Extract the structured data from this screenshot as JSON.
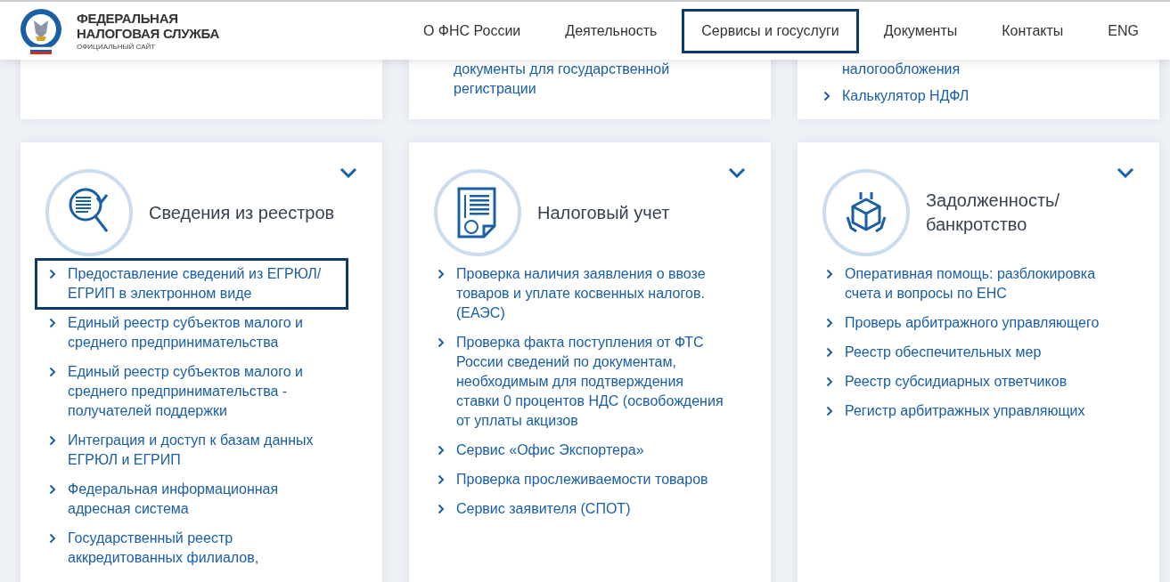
{
  "header": {
    "logo": {
      "title_line_1": "ФЕДЕРАЛЬНАЯ",
      "title_line_2": "НАЛОГОВАЯ СЛУЖБА",
      "subtitle": "ОФИЦИАЛЬНЫЙ САЙТ"
    },
    "nav": [
      {
        "label": "О ФНС России",
        "selected": false
      },
      {
        "label": "Деятельность",
        "selected": false
      },
      {
        "label": "Сервисы и госуслуги",
        "selected": true
      },
      {
        "label": "Документы",
        "selected": false
      },
      {
        "label": "Контакты",
        "selected": false
      },
      {
        "label": "ENG",
        "selected": false
      }
    ]
  },
  "top_cards": [
    {
      "kind": "blank"
    },
    {
      "kind": "links",
      "items": [
        {
          "kind": "continuation",
          "text": "документы для государственной"
        },
        {
          "kind": "continuation",
          "text": "регистрации"
        }
      ]
    },
    {
      "kind": "links",
      "items": [
        {
          "kind": "continuation",
          "text": "налогообложения"
        },
        {
          "kind": "link",
          "text": "Калькулятор НДФЛ"
        }
      ]
    }
  ],
  "sections": [
    {
      "title": "Сведения из реестров",
      "expanded": false,
      "items": [
        {
          "text": "Предоставление сведений из ЕГРЮЛ/ ЕГРИП в электронном виде",
          "selected": true
        },
        {
          "text": "Единый реестр субъектов малого и среднего предпринимательства",
          "selected": false
        },
        {
          "text": "Единый реестр субъектов малого и среднего предпринимательства - получателей поддержки",
          "selected": false
        },
        {
          "text": "Интеграция и доступ к базам данных ЕГРЮЛ и ЕГРИП",
          "selected": false
        },
        {
          "text": "Федеральная информационная адресная система",
          "selected": false
        },
        {
          "text": "Государственный реестр аккредитованных филиалов,",
          "selected": false
        }
      ]
    },
    {
      "title": "Налоговый учет",
      "expanded": false,
      "items": [
        {
          "text": "Проверка наличия заявления о ввозе товаров и уплате косвенных налогов. (ЕАЭС)",
          "selected": false
        },
        {
          "text": "Проверка факта поступления от ФТС России сведений по документам, необходимым для подтверждения ставки 0 процентов НДС (освобождения от уплаты акцизов",
          "selected": false
        },
        {
          "text": "Сервис «Офис Экспортера»",
          "selected": false
        },
        {
          "text": "Проверка прослеживаемости товаров",
          "selected": false
        },
        {
          "text": "Сервис заявителя (СПОТ)",
          "selected": false
        }
      ]
    },
    {
      "title": "Задолженность/ банкротство",
      "expanded": false,
      "items": [
        {
          "text": "Оперативная помощь: разблокировка счета и вопросы по ЕНС",
          "selected": false
        },
        {
          "text": "Проверь арбитражного управляющего",
          "selected": false
        },
        {
          "text": "Реестр обеспечительных мер",
          "selected": false
        },
        {
          "text": "Реестр субсидиарных ответчиков",
          "selected": false
        },
        {
          "text": "Регистр арбитражных управляющих",
          "selected": false
        }
      ]
    }
  ]
}
